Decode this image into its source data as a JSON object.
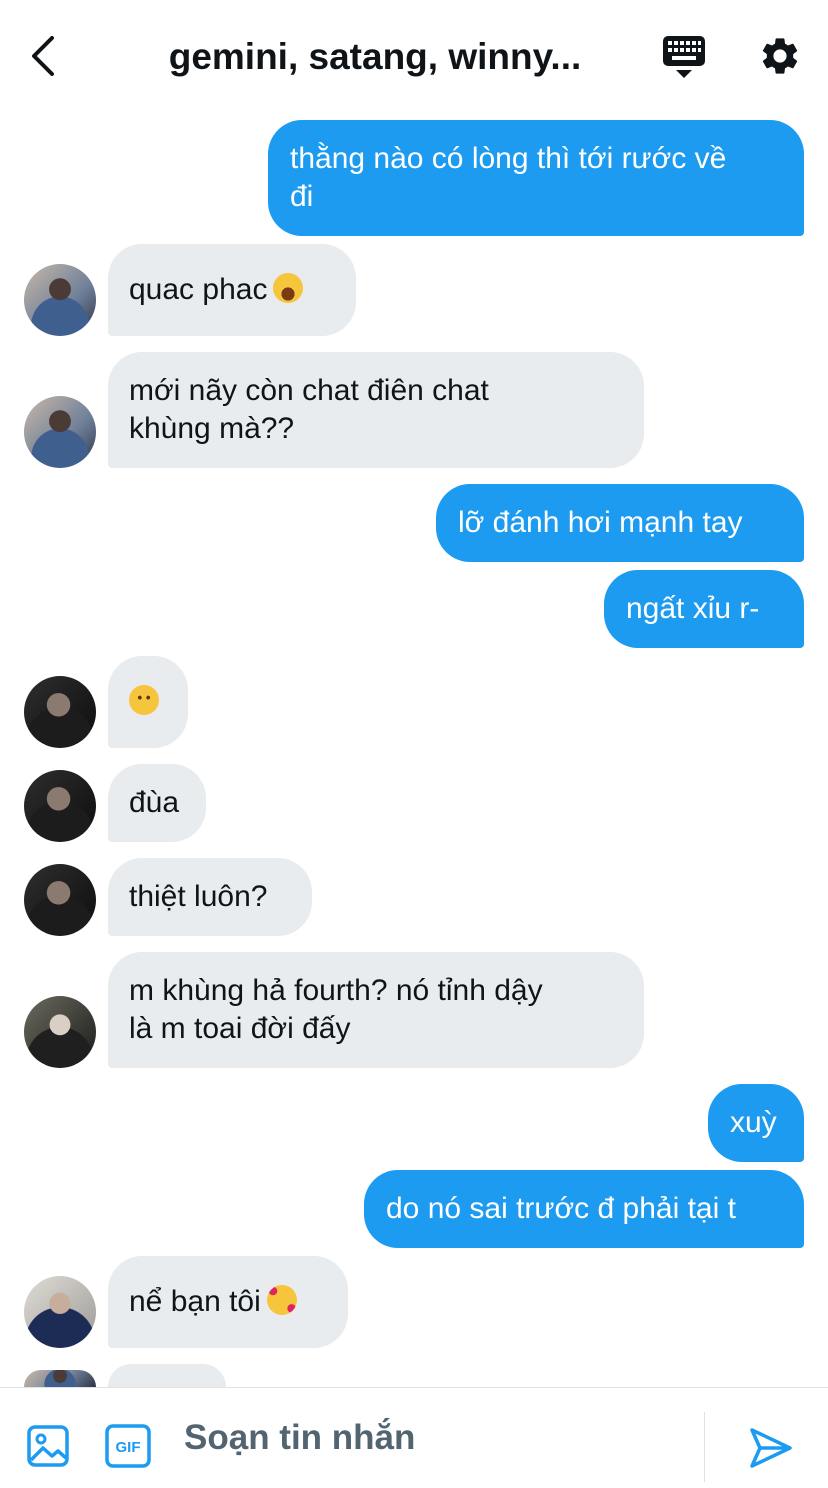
{
  "header": {
    "title": "gemini, satang, winny...",
    "back_icon": "chevron-left-icon",
    "keyboard_icon": "keyboard-icon",
    "settings_icon": "gear-icon"
  },
  "messages": [
    {
      "direction": "out",
      "text_line1": "thằng nào có lòng thì tới rước về",
      "text_line2": "đi"
    },
    {
      "direction": "in",
      "text": "quac phac",
      "emoji": "grinning-face-emoji"
    },
    {
      "direction": "in",
      "text_line1": "mới nãy còn chat điên chat",
      "text_line2": "khùng mà??"
    },
    {
      "direction": "out",
      "text": "lỡ đánh hơi mạnh tay"
    },
    {
      "direction": "out",
      "text": "ngất xỉu r-"
    },
    {
      "direction": "in",
      "emoji": "slightly-smiling-face-emoji"
    },
    {
      "direction": "in",
      "text": "đùa"
    },
    {
      "direction": "in",
      "text": "thiệt luôn?"
    },
    {
      "direction": "in",
      "text_line1": "m khùng hả fourth? nó tỉnh dậy",
      "text_line2": "là m toai đời đấy"
    },
    {
      "direction": "out",
      "text": "xuỳ"
    },
    {
      "direction": "out",
      "text": "do nó sai trước đ phải tại t"
    },
    {
      "direction": "in",
      "text": "nể bạn tôi",
      "emoji": "smiling-face-with-hearts-emoji"
    }
  ],
  "composer": {
    "placeholder": "Soạn tin nhắn",
    "image_icon": "image-icon",
    "gif_label": "GIF",
    "send_icon": "send-icon"
  },
  "colors": {
    "accent": "#1d9bf0",
    "incoming_bubble": "#e8ecef",
    "text": "#0f1419",
    "placeholder": "#536471"
  }
}
